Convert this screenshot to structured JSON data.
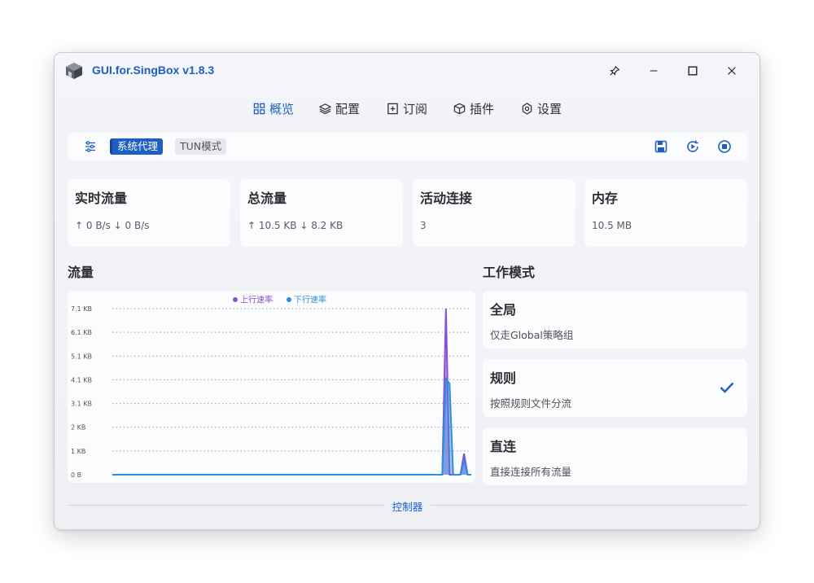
{
  "app": {
    "title": "GUI.for.SingBox v1.8.3"
  },
  "nav": [
    {
      "label": "概览",
      "icon": "grid-icon",
      "active": true
    },
    {
      "label": "配置",
      "icon": "layers-icon",
      "active": false
    },
    {
      "label": "订阅",
      "icon": "plus-square-icon",
      "active": false
    },
    {
      "label": "插件",
      "icon": "cube-icon",
      "active": false
    },
    {
      "label": "设置",
      "icon": "gear-icon",
      "active": false
    }
  ],
  "toolbar": {
    "system_proxy_label": "系统代理",
    "tun_label": "TUN模式"
  },
  "stats": [
    {
      "title": "实时流量",
      "value": "↑ 0 B/s ↓ 0 B/s"
    },
    {
      "title": "总流量",
      "value": "↑ 10.5 KB ↓ 8.2 KB"
    },
    {
      "title": "活动连接",
      "value": "3"
    },
    {
      "title": "内存",
      "value": "10.5 MB"
    }
  ],
  "traffic_section_title": "流量",
  "mode_section_title": "工作模式",
  "modes": [
    {
      "title": "全局",
      "desc": "仅走Global策略组",
      "selected": false
    },
    {
      "title": "规则",
      "desc": "按照规则文件分流",
      "selected": true
    },
    {
      "title": "直连",
      "desc": "直接连接所有流量",
      "selected": false
    }
  ],
  "footer": {
    "label": "控制器"
  },
  "colors": {
    "accent": "#1f5fc4",
    "upload": "#8a4fd6",
    "download": "#2f8fdc"
  },
  "chart_data": {
    "type": "area",
    "x": [
      0,
      1,
      2,
      3,
      4,
      5,
      6,
      7,
      8,
      9,
      10,
      11,
      12,
      13,
      14,
      15,
      16,
      17,
      18,
      19,
      20,
      21,
      22,
      23,
      24,
      25,
      26,
      27,
      28,
      29,
      30,
      31,
      32,
      33,
      34,
      35,
      36,
      37,
      38,
      39,
      40,
      41,
      42,
      43,
      44,
      45,
      46,
      47,
      48,
      49,
      50,
      51,
      52,
      53,
      54,
      55,
      56,
      57,
      58,
      59,
      60,
      61,
      62,
      63,
      64,
      65,
      66,
      67,
      68,
      69,
      70,
      71,
      72,
      73,
      74,
      75,
      76,
      77,
      78,
      79,
      80,
      81,
      82,
      83,
      84,
      85,
      86,
      87,
      88,
      89,
      90,
      91,
      92,
      93,
      94,
      95,
      96,
      97,
      98,
      99
    ],
    "series": [
      {
        "name": "上行速率",
        "color": "#8a4fd6",
        "values": [
          0,
          0,
          0,
          0,
          0,
          0,
          0,
          0,
          0,
          0,
          0,
          0,
          0,
          0,
          0,
          0,
          0,
          0,
          0,
          0,
          0,
          0,
          0,
          0,
          0,
          0,
          0,
          0,
          0,
          0,
          0,
          0,
          0,
          0,
          0,
          0,
          0,
          0,
          0,
          0,
          0,
          0,
          0,
          0,
          0,
          0,
          0,
          0,
          0,
          0,
          0,
          0,
          0,
          0,
          0,
          0,
          0,
          0,
          0,
          0,
          0,
          0,
          0,
          0,
          0,
          0,
          0,
          0,
          0,
          0,
          0,
          0,
          0,
          0,
          0,
          0,
          0,
          0,
          0,
          0,
          0,
          0,
          0,
          0,
          0,
          0,
          0,
          0,
          0,
          0,
          0,
          0,
          7.1,
          0,
          0,
          0,
          0,
          0.9,
          0,
          0
        ]
      },
      {
        "name": "下行速率",
        "color": "#2f8fdc",
        "values": [
          0,
          0,
          0,
          0,
          0,
          0,
          0,
          0,
          0,
          0,
          0,
          0,
          0,
          0,
          0,
          0,
          0,
          0,
          0,
          0,
          0,
          0,
          0,
          0,
          0,
          0,
          0,
          0,
          0,
          0,
          0,
          0,
          0,
          0,
          0,
          0,
          0,
          0,
          0,
          0,
          0,
          0,
          0,
          0,
          0,
          0,
          0,
          0,
          0,
          0,
          0,
          0,
          0,
          0,
          0,
          0,
          0,
          0,
          0,
          0,
          0,
          0,
          0,
          0,
          0,
          0,
          0,
          0,
          0,
          0,
          0,
          0,
          0,
          0,
          0,
          0,
          0,
          0,
          0,
          0,
          0,
          0,
          0,
          0,
          0,
          0,
          0,
          0,
          0,
          0,
          0,
          0,
          4.1,
          3.9,
          0,
          0,
          0,
          0.6,
          0,
          0
        ]
      }
    ],
    "yticks": [
      "7.1 KB",
      "6.1 KB",
      "5.1 KB",
      "4.1 KB",
      "3.1 KB",
      "2 KB",
      "1 KB",
      "0 B"
    ],
    "ylim": [
      0,
      7.1
    ],
    "legend": "top-center",
    "grid": true
  }
}
